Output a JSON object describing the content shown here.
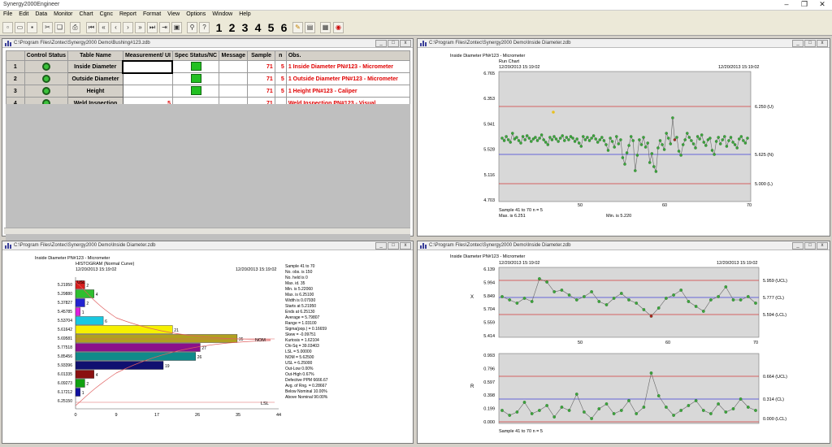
{
  "app": {
    "title": "Synergy2000Engineer"
  },
  "menu": [
    "File",
    "Edit",
    "Data",
    "Monitor",
    "Chart",
    "Cgnc",
    "Report",
    "Format",
    "View",
    "Options",
    "Window",
    "Help"
  ],
  "toolbar": {
    "digits": [
      "1",
      "2",
      "3",
      "4",
      "5",
      "6"
    ]
  },
  "grid": {
    "title": "C:\\Program Files\\Zontec\\Synergy2000 Demo\\Bushing#123.zdb",
    "headers": [
      "Control Status",
      "Table Name",
      "Measurement/ UI",
      "Spec Status/NC",
      "Message",
      "Sample",
      "n",
      "Obs."
    ],
    "rows": [
      {
        "num": "1",
        "name": "Inside Diameter",
        "meas": "",
        "sample": "71",
        "n": "5",
        "obs": "1 Inside Diameter PN#123 - Micrometer"
      },
      {
        "num": "2",
        "name": "Outside Diameter",
        "meas": "",
        "sample": "71",
        "n": "5",
        "obs": "1 Outside Diameter PN#123 - Micrometer"
      },
      {
        "num": "3",
        "name": "Height",
        "meas": "",
        "sample": "71",
        "n": "5",
        "obs": "1 Height PN#123 - Caliper"
      },
      {
        "num": "4",
        "name": "Weld Inspection",
        "meas": "5",
        "sample": "71",
        "n": "",
        "obs": "Weld Inspection PN#123 - Visual"
      }
    ]
  },
  "run": {
    "title": "C:\\Program Files\\Zontec\\Synergy2000 Demo\\Inside Diameter.zdb",
    "heading": "Inside Diameter PN#123 - Micrometer",
    "subheading": "Run Chart",
    "date1": "12/20/2013  15:19:02",
    "date2": "12/20/2013  15:19:02",
    "yticks": [
      "6.765",
      "6.353",
      "5.941",
      "5.528",
      "5.116",
      "4.703"
    ],
    "xticks": [
      "50",
      "60",
      "70"
    ],
    "limits": [
      "6.250 (U)",
      "5.625 (N)",
      "5.000 (L)"
    ],
    "footer": [
      "Sample  41  to  70   n = 5",
      "Max. is 6.251",
      "Min. is 5.220"
    ]
  },
  "hist": {
    "title": "C:\\Program Files\\Zontec\\Synergy2000 Demo\\Inside Diameter.zdb",
    "heading": "Inside Diameter PN#123 - Micrometer",
    "subheading": "HISTOGRAM (Normal Curve)",
    "date1": "12/20/2013  15:19:02",
    "date2": "12/20/2013  15:19:02",
    "xticks": [
      "0",
      "9",
      "17",
      "26",
      "35",
      "44"
    ],
    "labels": {
      "usl": "USL",
      "nom": "NOM",
      "lsl": "LSL"
    },
    "stats": [
      "Sample  41  to  70",
      "No. obs. is 150",
      "No. held is 0",
      "Max. id. 35",
      "Min. is 5.22060",
      "Max. is 6.25100",
      "Width is 0.07930",
      "Starts at 5.21950",
      "Ends at 6.25130",
      "Average = 5.79807",
      "Range = 1.03100",
      "Sigma(pop.) = 0.16659",
      "Skew = -0.09751",
      "Kurtosis = 1.62104",
      "Chi-Sq = 39.03403",
      "LSL = 5.00000",
      "NOM = 5.62500",
      "USL = 6.25000",
      "Out-Low   0.00%",
      "Out-High  0.67%",
      "Defective PPM  6666.67",
      "Avg. of Rng. = 0.28667",
      "Below Nominal  10.00%",
      "Above Nominal  90.00%"
    ]
  },
  "xbar": {
    "title": "C:\\Program Files\\Zontec\\Synergy2000 Demo\\Inside Diameter.zdb",
    "heading": "Inside Diameter PN#123 - Micrometer",
    "date1": "12/20/2013  15:19:02",
    "date2": "12/20/2013  15:19:02",
    "yticks": [
      "6.139",
      "5.994",
      "5.849",
      "5.704",
      "5.559",
      "5.414"
    ],
    "xticks": [
      "50",
      "60",
      "70"
    ],
    "limits": [
      "5.959 (UCL)",
      "5.777 (CL)",
      "5.594 (LCL)"
    ],
    "ylabel": "X",
    "rticks": [
      "0.993",
      "0.796",
      "0.597",
      "0.398",
      "0.199",
      "0.000"
    ],
    "rlimits": [
      "0.664 (UCL)",
      "0.314 (CL)",
      "0.000 (LCL)"
    ],
    "rlabel": "R",
    "footer": "Sample  41  to  70   n = 5"
  }
}
